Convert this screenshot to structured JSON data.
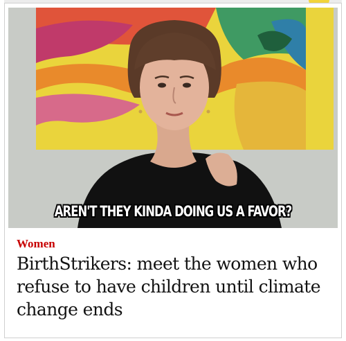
{
  "meme": {
    "caption": "AREN'T THEY KINDA DOING US A FAVOR?"
  },
  "article": {
    "section": "Women",
    "headline": "BirthStrikers: meet the women who refuse to have children until climate change ends"
  },
  "colors": {
    "section_accent": "#c70000",
    "headline_text": "#121212"
  }
}
